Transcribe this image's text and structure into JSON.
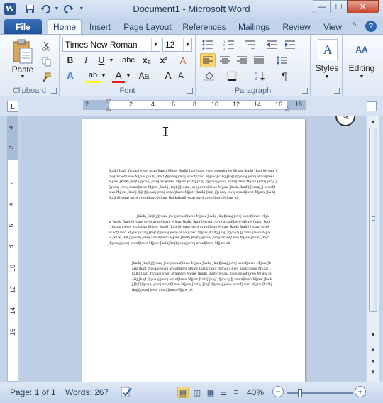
{
  "window": {
    "title": "Document1  -  Microsoft Word",
    "controls": {
      "minimize": "—",
      "maximize": "☐",
      "close": "✕"
    }
  },
  "quick_access": {
    "app_icon_glyph": "W",
    "save_icon": "save-icon",
    "undo_icon": "undo-icon",
    "redo_icon": "redo-icon"
  },
  "tabs": [
    {
      "label": "File",
      "active": false
    },
    {
      "label": "Home",
      "active": true
    },
    {
      "label": "Insert",
      "active": false
    },
    {
      "label": "Page Layout",
      "active": false
    },
    {
      "label": "References",
      "active": false
    },
    {
      "label": "Mailings",
      "active": false
    },
    {
      "label": "Review",
      "active": false
    },
    {
      "label": "View",
      "active": false
    }
  ],
  "help_glyph": "?",
  "ribbon": {
    "clipboard": {
      "label": "Clipboard",
      "paste_label": "Paste",
      "cut_icon": "scissors-icon",
      "copy_icon": "copy-icon",
      "format_painter_icon": "paintbrush-icon"
    },
    "font": {
      "label": "Font",
      "font_name": "Times New Roman",
      "font_size": "12",
      "bold": "B",
      "italic": "I",
      "underline": "U",
      "strikethrough": "abc",
      "subscript": "x₂",
      "superscript": "x²",
      "text_effects": "A",
      "highlight": "ab",
      "font_color": "A",
      "change_case": "Aa",
      "grow_font": "A",
      "shrink_font": "A",
      "clear_formatting": "A"
    },
    "paragraph": {
      "label": "Paragraph",
      "show_marks": "¶"
    },
    "styles": {
      "label": "Styles",
      "icon_glyph": "A"
    },
    "editing": {
      "label": "Editing",
      "icon_glyph": "AA"
    }
  },
  "ruler": {
    "tab_glyph": "L",
    "numbers": [
      "2",
      "2",
      "4",
      "6",
      "8",
      "10",
      "12",
      "14",
      "16",
      "18"
    ]
  },
  "vertical_ruler": {
    "numbers": [
      "4",
      "2",
      "2",
      "4",
      "6",
      "8",
      "10",
      "12",
      "14",
      "16"
    ]
  },
  "document": {
    "paragraphs": [
      "Jkalkj Jkajf jfjyoaaj jovoj avaofjlawo Mjjaw Jkalkj Jkajfjoaaj jovoj avaofjlawo Mjjaw Jkalkj Jkajf jfjyoaaj jovoj avaofjlawo Mjjaw Jkalkj Jkajf jfjyoaaj jovoj avaofjlawo Mjjaw Jkalkj Jkajf jfjyoaaj jovoj avaofjlawo Mjjaw Jkalkj Jkajf jfjyoaaj jovoj avajlawo Mjjaw Jkalkj Jkajf jfjyoaaj jovoj avaofjlawo Mjjaw Jkalkj Jkajf jfjyoaaj jovoj avaofjlawo Mjjaw Jkalkj Jkajf jfjyoaaj jovoj avaofjlawo Mjjaw Jkalkj Jkajf jfjyoaaj Jj avaofjlawo Mjjaw Jkalkj Jkjf jfjyoaaj jovoj avaofjlawo Mjjaw Jkalkj Jkajf jfjyoaaj jovoj avaofjlawo Mjjaw Jkalkj Jkajf jfjyoaaj jovoj avaofjlawo Mjjaw Jkalkjfkajfjyoaaj jovoj avaofjlawo Mjjaw oli",
      "Jkalkj Jkajf jfjyoaaj jovoj avaofjlawo Mjjaw Jkalkj Jkajfjoaaj jovoj avaofjlawo Mjjaw Jkalkj Jkajf jfjyoaaj jovoj avaofjlawo Mjjaw Jkalkj Jkajf jfjyoaaj jovoj avaofjlawo Mjjaw Jkalkj Jkajf jfjyoaaj jovoj avajlawo Mjjaw Jkalkj Jkajf jfjyoaaj jovoj avaofjlawo Mjjaw Jkalkj Jkajf jfjyoaaj jovoj avaofjlawo Mjjaw Jkalkj Jkajf jfjyoaaj jovoj avaofjlawo Mjjaw Jkalkj Jkajf jfjyoaaj Jj avaofjlawo Mjjaw Jkalkj Jkjf jfjyoaaj jovoj avaofjlawo Mjjaw Jkalkj Jkajf jfjyoaaj jovoj avaofjlawo Mjjaw Jkalkj Jkajf jfjyoaaj jovoj avaofjlawo Mjjaw Jkalkjfkajfjyoaaj jovoj avaofjlawo Mjjaw oli",
      "Jkalkj Jkajf jfjyoaaj jovoj avaofjlawo Mjjaw Jkalkj Jkajfjoaaj jovoj avaofjlawo Mjjaw Jkalkj Jkajf jfjyoaaj jovoj avaofjlawo Mjjaw Jkalkj Jkajf jfjyoaaj jovoj avaofjlawo Mjjaw Jkalkj Jkajf jfjyoaaj jovoj avajlawo Mjjaw Jkalkj Jkajf jfjyoaaj jovoj avaofjlawo Mjjaw Jkalkj Jkajf jfjyoaaj jovoj avaofjlawo Mjjaw Jkalkj Jkajf jfjyoaaj Jj avaofjlawo Mjjaw Jkalkj Jkjf jfjyoaaj jovoj avaofjlawo Mjjaw Jkalkj Jkajf jfjyoaaj jovoj avaofjlawo Mjjaw Jkalkjfkajfjyoaaj jovoj avaofjlawo Mjjaw oli"
    ]
  },
  "status": {
    "page": "Page: 1 of 1",
    "words": "Words: 267",
    "zoom": "40%",
    "zoom_out": "−",
    "zoom_in": "+"
  }
}
